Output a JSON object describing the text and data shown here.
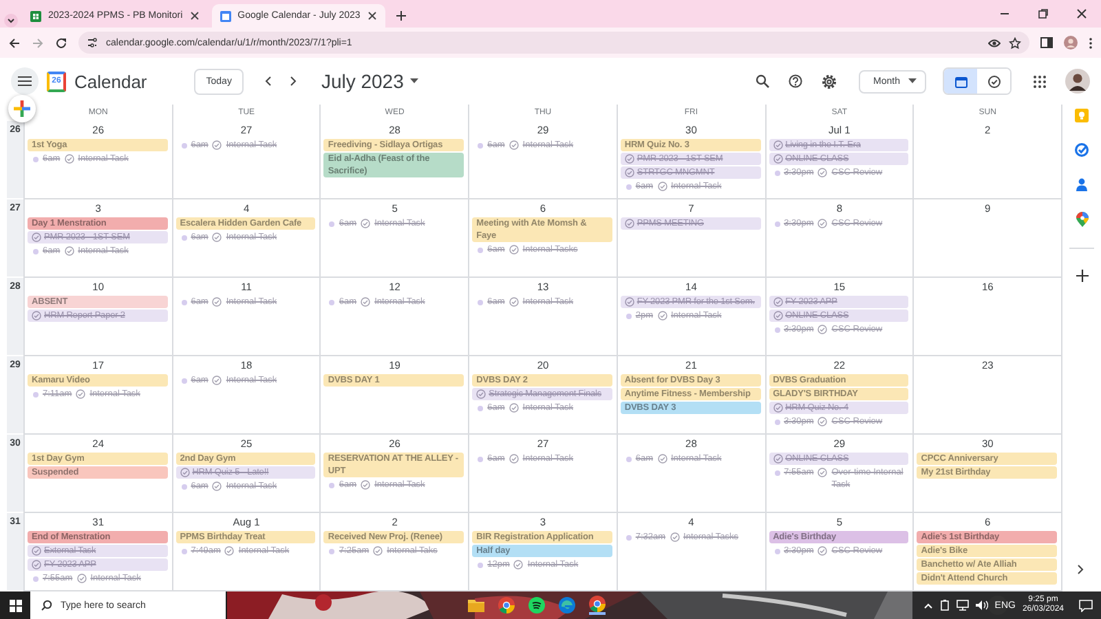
{
  "browser": {
    "tabs": [
      {
        "title": "2023-2024 PPMS - PB Monitori",
        "kind": "sheets",
        "selected": false
      },
      {
        "title": "Google Calendar - July 2023",
        "kind": "calendar",
        "selected": true
      }
    ],
    "url": "calendar.google.com/calendar/u/1/r/month/2023/7/1?pli=1"
  },
  "app_bar": {
    "logo_text": "26",
    "title": "Calendar",
    "today_button": "Today",
    "period": "July 2023",
    "view_menu": "Month",
    "view_toggle": [
      {
        "kind": "calendar",
        "selected": true
      },
      {
        "kind": "tasks",
        "selected": false
      }
    ]
  },
  "calendar": {
    "weekdays": [
      "MON",
      "TUE",
      "WED",
      "THU",
      "FRI",
      "SAT",
      "SUN"
    ],
    "weeks": [
      {
        "week_number": "26",
        "days": [
          {
            "date": "26",
            "events": [
              {
                "kind": "allday",
                "title": "1st Yoga",
                "color": "#fbe7b5"
              },
              {
                "kind": "timed",
                "time": "6am",
                "title": "Internal Task",
                "done": true
              }
            ]
          },
          {
            "date": "27",
            "events": [
              {
                "kind": "timed",
                "time": "6am",
                "title": "Internal Task",
                "done": true
              }
            ]
          },
          {
            "date": "28",
            "events": [
              {
                "kind": "allday",
                "title": "Freediving - Sidlaya Ortigas",
                "color": "#fbe7b5"
              },
              {
                "kind": "allday",
                "title": "Eid al-Adha (Feast of the Sacrifice)",
                "color": "#b6dcc8"
              }
            ]
          },
          {
            "date": "29",
            "events": [
              {
                "kind": "timed",
                "time": "6am",
                "title": "Internal Task",
                "done": true
              }
            ]
          },
          {
            "date": "30",
            "events": [
              {
                "kind": "allday",
                "title": "HRM Quiz No. 3",
                "color": "#fbe7b5"
              },
              {
                "kind": "task",
                "title": "PMR 2023 - 1ST SEM",
                "done": true
              },
              {
                "kind": "task",
                "title": "STRTGC MNGMNT",
                "done": true
              },
              {
                "kind": "timed",
                "time": "6am",
                "title": "Internal Task",
                "done": true
              }
            ]
          },
          {
            "date": "Jul 1",
            "events": [
              {
                "kind": "task",
                "title": "Living in the I.T. Era",
                "done": true
              },
              {
                "kind": "task",
                "title": "ONLINE CLASS",
                "done": true
              },
              {
                "kind": "timed",
                "time": "3:30pm",
                "title": "CSC Review",
                "done": true
              }
            ]
          },
          {
            "date": "2"
          }
        ]
      },
      {
        "week_number": "27",
        "days": [
          {
            "date": "3",
            "events": [
              {
                "kind": "allday",
                "title": "Day 1 Menstration",
                "color": "#f2adad"
              },
              {
                "kind": "task",
                "title": "PMR 2023 - 1ST SEM",
                "done": true
              },
              {
                "kind": "timed",
                "time": "6am",
                "title": "Internal Task",
                "done": true
              }
            ]
          },
          {
            "date": "4",
            "events": [
              {
                "kind": "allday",
                "title": "Escalera Hidden Garden Cafe",
                "color": "#fbe7b5"
              },
              {
                "kind": "timed",
                "time": "6am",
                "title": "Internal Task",
                "done": true
              }
            ]
          },
          {
            "date": "5",
            "events": [
              {
                "kind": "timed",
                "time": "6am",
                "title": "Internal Task",
                "done": true
              }
            ]
          },
          {
            "date": "6",
            "events": [
              {
                "kind": "allday",
                "title": "Meeting with Ate Momsh & Faye",
                "color": "#fbe7b5"
              },
              {
                "kind": "timed",
                "time": "6am",
                "title": "Internal Tasks",
                "done": true
              }
            ]
          },
          {
            "date": "7",
            "events": [
              {
                "kind": "task",
                "title": "PPMS MEETING",
                "done": true
              }
            ]
          },
          {
            "date": "8",
            "events": [
              {
                "kind": "timed",
                "time": "3:30pm",
                "title": "CSC Review",
                "done": true
              }
            ]
          },
          {
            "date": "9"
          }
        ]
      },
      {
        "week_number": "28",
        "days": [
          {
            "date": "10",
            "events": [
              {
                "kind": "allday",
                "title": "ABSENT",
                "color": "#f8d4d4"
              },
              {
                "kind": "task",
                "title": "HRM Report Paper 2",
                "done": true
              }
            ]
          },
          {
            "date": "11",
            "events": [
              {
                "kind": "timed",
                "time": "6am",
                "title": "Internal Task",
                "done": true
              }
            ]
          },
          {
            "date": "12",
            "events": [
              {
                "kind": "timed",
                "time": "6am",
                "title": "Internal Task",
                "done": true
              }
            ]
          },
          {
            "date": "13",
            "events": [
              {
                "kind": "timed",
                "time": "6am",
                "title": "Internal Task",
                "done": true
              }
            ]
          },
          {
            "date": "14",
            "events": [
              {
                "kind": "task",
                "title": "FY 2023 PMR for the 1st Sem.",
                "done": true
              },
              {
                "kind": "timed",
                "time": "2pm",
                "title": "Internal Task",
                "done": true
              }
            ]
          },
          {
            "date": "15",
            "events": [
              {
                "kind": "task",
                "title": "FY 2023 APP",
                "done": true
              },
              {
                "kind": "task",
                "title": "ONLINE CLASS",
                "done": true
              },
              {
                "kind": "timed",
                "time": "3:30pm",
                "title": "CSC Review",
                "done": true
              }
            ]
          },
          {
            "date": "16"
          }
        ]
      },
      {
        "week_number": "29",
        "days": [
          {
            "date": "17",
            "events": [
              {
                "kind": "allday",
                "title": "Kamaru Video",
                "color": "#fbe7b5"
              },
              {
                "kind": "timed",
                "time": "7:11am",
                "title": "Internal Task",
                "done": true
              }
            ]
          },
          {
            "date": "18",
            "events": [
              {
                "kind": "timed",
                "time": "6am",
                "title": "Internal Task",
                "done": true
              }
            ]
          },
          {
            "date": "19",
            "events": [
              {
                "kind": "allday",
                "title": "DVBS DAY 1",
                "color": "#fbe7b5"
              }
            ]
          },
          {
            "date": "20",
            "events": [
              {
                "kind": "allday",
                "title": "DVBS DAY 2",
                "color": "#fbe7b5"
              },
              {
                "kind": "task",
                "title": "Strategic Management Finals",
                "done": true
              },
              {
                "kind": "timed",
                "time": "6am",
                "title": "Internal Task",
                "done": true
              }
            ]
          },
          {
            "date": "21",
            "events": [
              {
                "kind": "allday",
                "title": "Absent for DVBS Day 3",
                "color": "#fbe7b5"
              },
              {
                "kind": "allday",
                "title": "Anytime Fitness - Membership",
                "color": "#fbe7b5"
              },
              {
                "kind": "allday",
                "title": "DVBS DAY 3",
                "color": "#b3dff5"
              }
            ]
          },
          {
            "date": "22",
            "events": [
              {
                "kind": "allday",
                "title": "DVBS Graduation",
                "color": "#fbe7b5"
              },
              {
                "kind": "allday",
                "title": "GLADY'S BIRTHDAY",
                "color": "#fbe7b5"
              },
              {
                "kind": "task",
                "title": "HRM Quiz No. 4",
                "done": true
              },
              {
                "kind": "timed",
                "time": "3:30pm",
                "title": "CSC Review",
                "done": true
              }
            ]
          },
          {
            "date": "23"
          }
        ]
      },
      {
        "week_number": "30",
        "days": [
          {
            "date": "24",
            "events": [
              {
                "kind": "allday",
                "title": "1st Day Gym",
                "color": "#fbe7b5"
              },
              {
                "kind": "allday",
                "title": "Suspended",
                "color": "#f9c6bd"
              }
            ]
          },
          {
            "date": "25",
            "events": [
              {
                "kind": "allday",
                "title": "2nd Day Gym",
                "color": "#fbe7b5"
              },
              {
                "kind": "task",
                "title": "HRM Quiz 5 - Late!!",
                "done": true
              },
              {
                "kind": "timed",
                "time": "6am",
                "title": "Internal Task",
                "done": true
              }
            ]
          },
          {
            "date": "26",
            "events": [
              {
                "kind": "allday",
                "title": "RESERVATION AT THE ALLEY - UPT",
                "color": "#fbe7b5"
              },
              {
                "kind": "timed",
                "time": "6am",
                "title": "Internal Task",
                "done": true
              }
            ]
          },
          {
            "date": "27",
            "events": [
              {
                "kind": "timed",
                "time": "6am",
                "title": "Internal Task",
                "done": true
              }
            ]
          },
          {
            "date": "28",
            "events": [
              {
                "kind": "timed",
                "time": "6am",
                "title": "Internal Task",
                "done": true
              }
            ]
          },
          {
            "date": "29",
            "events": [
              {
                "kind": "task",
                "title": "ONLINE CLASS",
                "done": true
              },
              {
                "kind": "timed",
                "time": "7:55am",
                "title": "Over-time Internal Task",
                "done": true
              }
            ]
          },
          {
            "date": "30",
            "events": [
              {
                "kind": "allday",
                "title": "CPCC Anniversary",
                "color": "#fbe7b5"
              },
              {
                "kind": "allday",
                "title": "My 21st Birthday",
                "color": "#fbe7b5"
              }
            ]
          }
        ]
      },
      {
        "week_number": "31",
        "days": [
          {
            "date": "31",
            "events": [
              {
                "kind": "allday",
                "title": "End of Menstration",
                "color": "#f2adad"
              },
              {
                "kind": "task",
                "title": "External Task",
                "done": true
              },
              {
                "kind": "task",
                "title": "FY 2023 APP",
                "done": true
              },
              {
                "kind": "timed",
                "time": "7:55am",
                "title": "Internal Task",
                "done": true
              }
            ]
          },
          {
            "date": "Aug 1",
            "events": [
              {
                "kind": "allday",
                "title": "PPMS Birthday Treat",
                "color": "#fbe7b5"
              },
              {
                "kind": "timed",
                "time": "7:49am",
                "title": "Internal Task",
                "done": true
              }
            ]
          },
          {
            "date": "2",
            "events": [
              {
                "kind": "allday",
                "title": "Received New Proj. (Renee)",
                "color": "#fbe7b5"
              },
              {
                "kind": "timed",
                "time": "7:25am",
                "title": "Internal Taks",
                "done": true
              }
            ]
          },
          {
            "date": "3",
            "events": [
              {
                "kind": "allday",
                "title": "BIR Registration Application",
                "color": "#fbe7b5"
              },
              {
                "kind": "allday",
                "title": "Half day",
                "color": "#b3dff5"
              },
              {
                "kind": "timed",
                "time": "12pm",
                "title": "Internal Task",
                "done": true
              }
            ]
          },
          {
            "date": "4",
            "events": [
              {
                "kind": "timed",
                "time": "7:32am",
                "title": "Internal Tasks",
                "done": true
              }
            ]
          },
          {
            "date": "5",
            "events": [
              {
                "kind": "allday",
                "title": "Adie's Birthday",
                "color": "#dcc0e6"
              },
              {
                "kind": "timed",
                "time": "3:30pm",
                "title": "CSC Review",
                "done": true
              }
            ]
          },
          {
            "date": "6",
            "events": [
              {
                "kind": "allday",
                "title": "Adie's 1st Birthday",
                "color": "#f2adad"
              },
              {
                "kind": "allday",
                "title": "Adie's Bike",
                "color": "#fbe7b5"
              },
              {
                "kind": "allday",
                "title": "Banchetto w/ Ate Alliah",
                "color": "#fbe7b5"
              },
              {
                "kind": "allday",
                "title": "Didn't Attend Church",
                "color": "#fbe7b5"
              }
            ]
          }
        ]
      }
    ]
  },
  "taskbar": {
    "search_placeholder": "Type here to search",
    "language": "ENG",
    "time": "9:25 pm",
    "date": "26/03/2024"
  }
}
